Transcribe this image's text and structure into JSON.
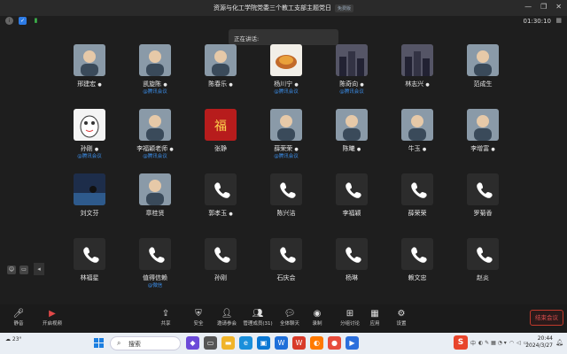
{
  "window": {
    "title": "资源与化工学院党委三个教工支部主题党日",
    "badge": "免费版",
    "controls": [
      "—",
      "❐",
      "✕"
    ]
  },
  "meeting": {
    "timer": "01:30:10",
    "speaking_label": "正在讲话:"
  },
  "participants": [
    {
      "name": "邢建宏",
      "mic": "🎙",
      "sub": "",
      "avatar": "person"
    },
    {
      "name": "凯旋陈",
      "mic": "🎙",
      "sub": "@腾讯会议",
      "avatar": "person"
    },
    {
      "name": "陈春乐",
      "mic": "🎙",
      "sub": "",
      "avatar": "person"
    },
    {
      "name": "杨川宁",
      "mic": "🎙",
      "sub": "@腾讯会议",
      "avatar": "food"
    },
    {
      "name": "陈奇向",
      "mic": "🎙",
      "sub": "@腾讯会议",
      "avatar": "city"
    },
    {
      "name": "林志兴",
      "mic": "🎙",
      "sub": "",
      "avatar": "city"
    },
    {
      "name": "范成生",
      "mic": "",
      "sub": "",
      "avatar": "person"
    },
    {
      "name": "孙刚",
      "mic": "🎙",
      "sub": "@腾讯会议",
      "avatar": "cartoon"
    },
    {
      "name": "李福颖老师",
      "mic": "🎙",
      "sub": "@腾讯会议",
      "avatar": "person"
    },
    {
      "name": "张静",
      "mic": "",
      "sub": "",
      "avatar": "red"
    },
    {
      "name": "薛荣荣",
      "mic": "🎙",
      "sub": "@腾讯会议",
      "avatar": "person"
    },
    {
      "name": "陈曦",
      "mic": "🎙",
      "sub": "",
      "avatar": "person"
    },
    {
      "name": "牛玉",
      "mic": "🎙",
      "sub": "",
      "avatar": "person"
    },
    {
      "name": "李增富",
      "mic": "🎙",
      "sub": "",
      "avatar": "person"
    },
    {
      "name": "刘文芬",
      "mic": "",
      "sub": "",
      "avatar": "sea"
    },
    {
      "name": "章桂贤",
      "mic": "",
      "sub": "",
      "avatar": "person"
    },
    {
      "name": "郭孝玉",
      "mic": "🎙",
      "sub": "",
      "avatar": "phone"
    },
    {
      "name": "陈兴洁",
      "mic": "",
      "sub": "",
      "avatar": "phone"
    },
    {
      "name": "李福颖",
      "mic": "",
      "sub": "",
      "avatar": "phone"
    },
    {
      "name": "薛荣荣",
      "mic": "",
      "sub": "",
      "avatar": "phone"
    },
    {
      "name": "罗菊香",
      "mic": "",
      "sub": "",
      "avatar": "phone"
    },
    {
      "name": "林福星",
      "mic": "",
      "sub": "",
      "avatar": "phone"
    },
    {
      "name": "值得信赖",
      "mic": "",
      "sub": "@微信",
      "avatar": "phone"
    },
    {
      "name": "孙刚",
      "mic": "",
      "sub": "",
      "avatar": "phone"
    },
    {
      "name": "石庆会",
      "mic": "",
      "sub": "",
      "avatar": "phone"
    },
    {
      "name": "杨琳",
      "mic": "",
      "sub": "",
      "avatar": "phone"
    },
    {
      "name": "赖文忠",
      "mic": "",
      "sub": "",
      "avatar": "phone"
    },
    {
      "name": "赵炎",
      "mic": "",
      "sub": "",
      "avatar": "phone"
    }
  ],
  "toolbar": {
    "mute": "静音",
    "video": "开启视频",
    "share": "共享",
    "security": "安全",
    "invite": "邀请参会",
    "manage": "管理成员(31)",
    "chat": "全体聊天",
    "record": "录制",
    "breakout": "分组讨论",
    "apps": "应用",
    "settings": "设置",
    "end": "结束会议"
  },
  "taskbar": {
    "weather": "23°",
    "search_placeholder": "搜索",
    "ime": "中",
    "time": "20:44",
    "date": "2024/3/27"
  },
  "colors": {
    "accent": "#3b8de8",
    "end": "#e05050",
    "bg": "#1e1e1e"
  }
}
